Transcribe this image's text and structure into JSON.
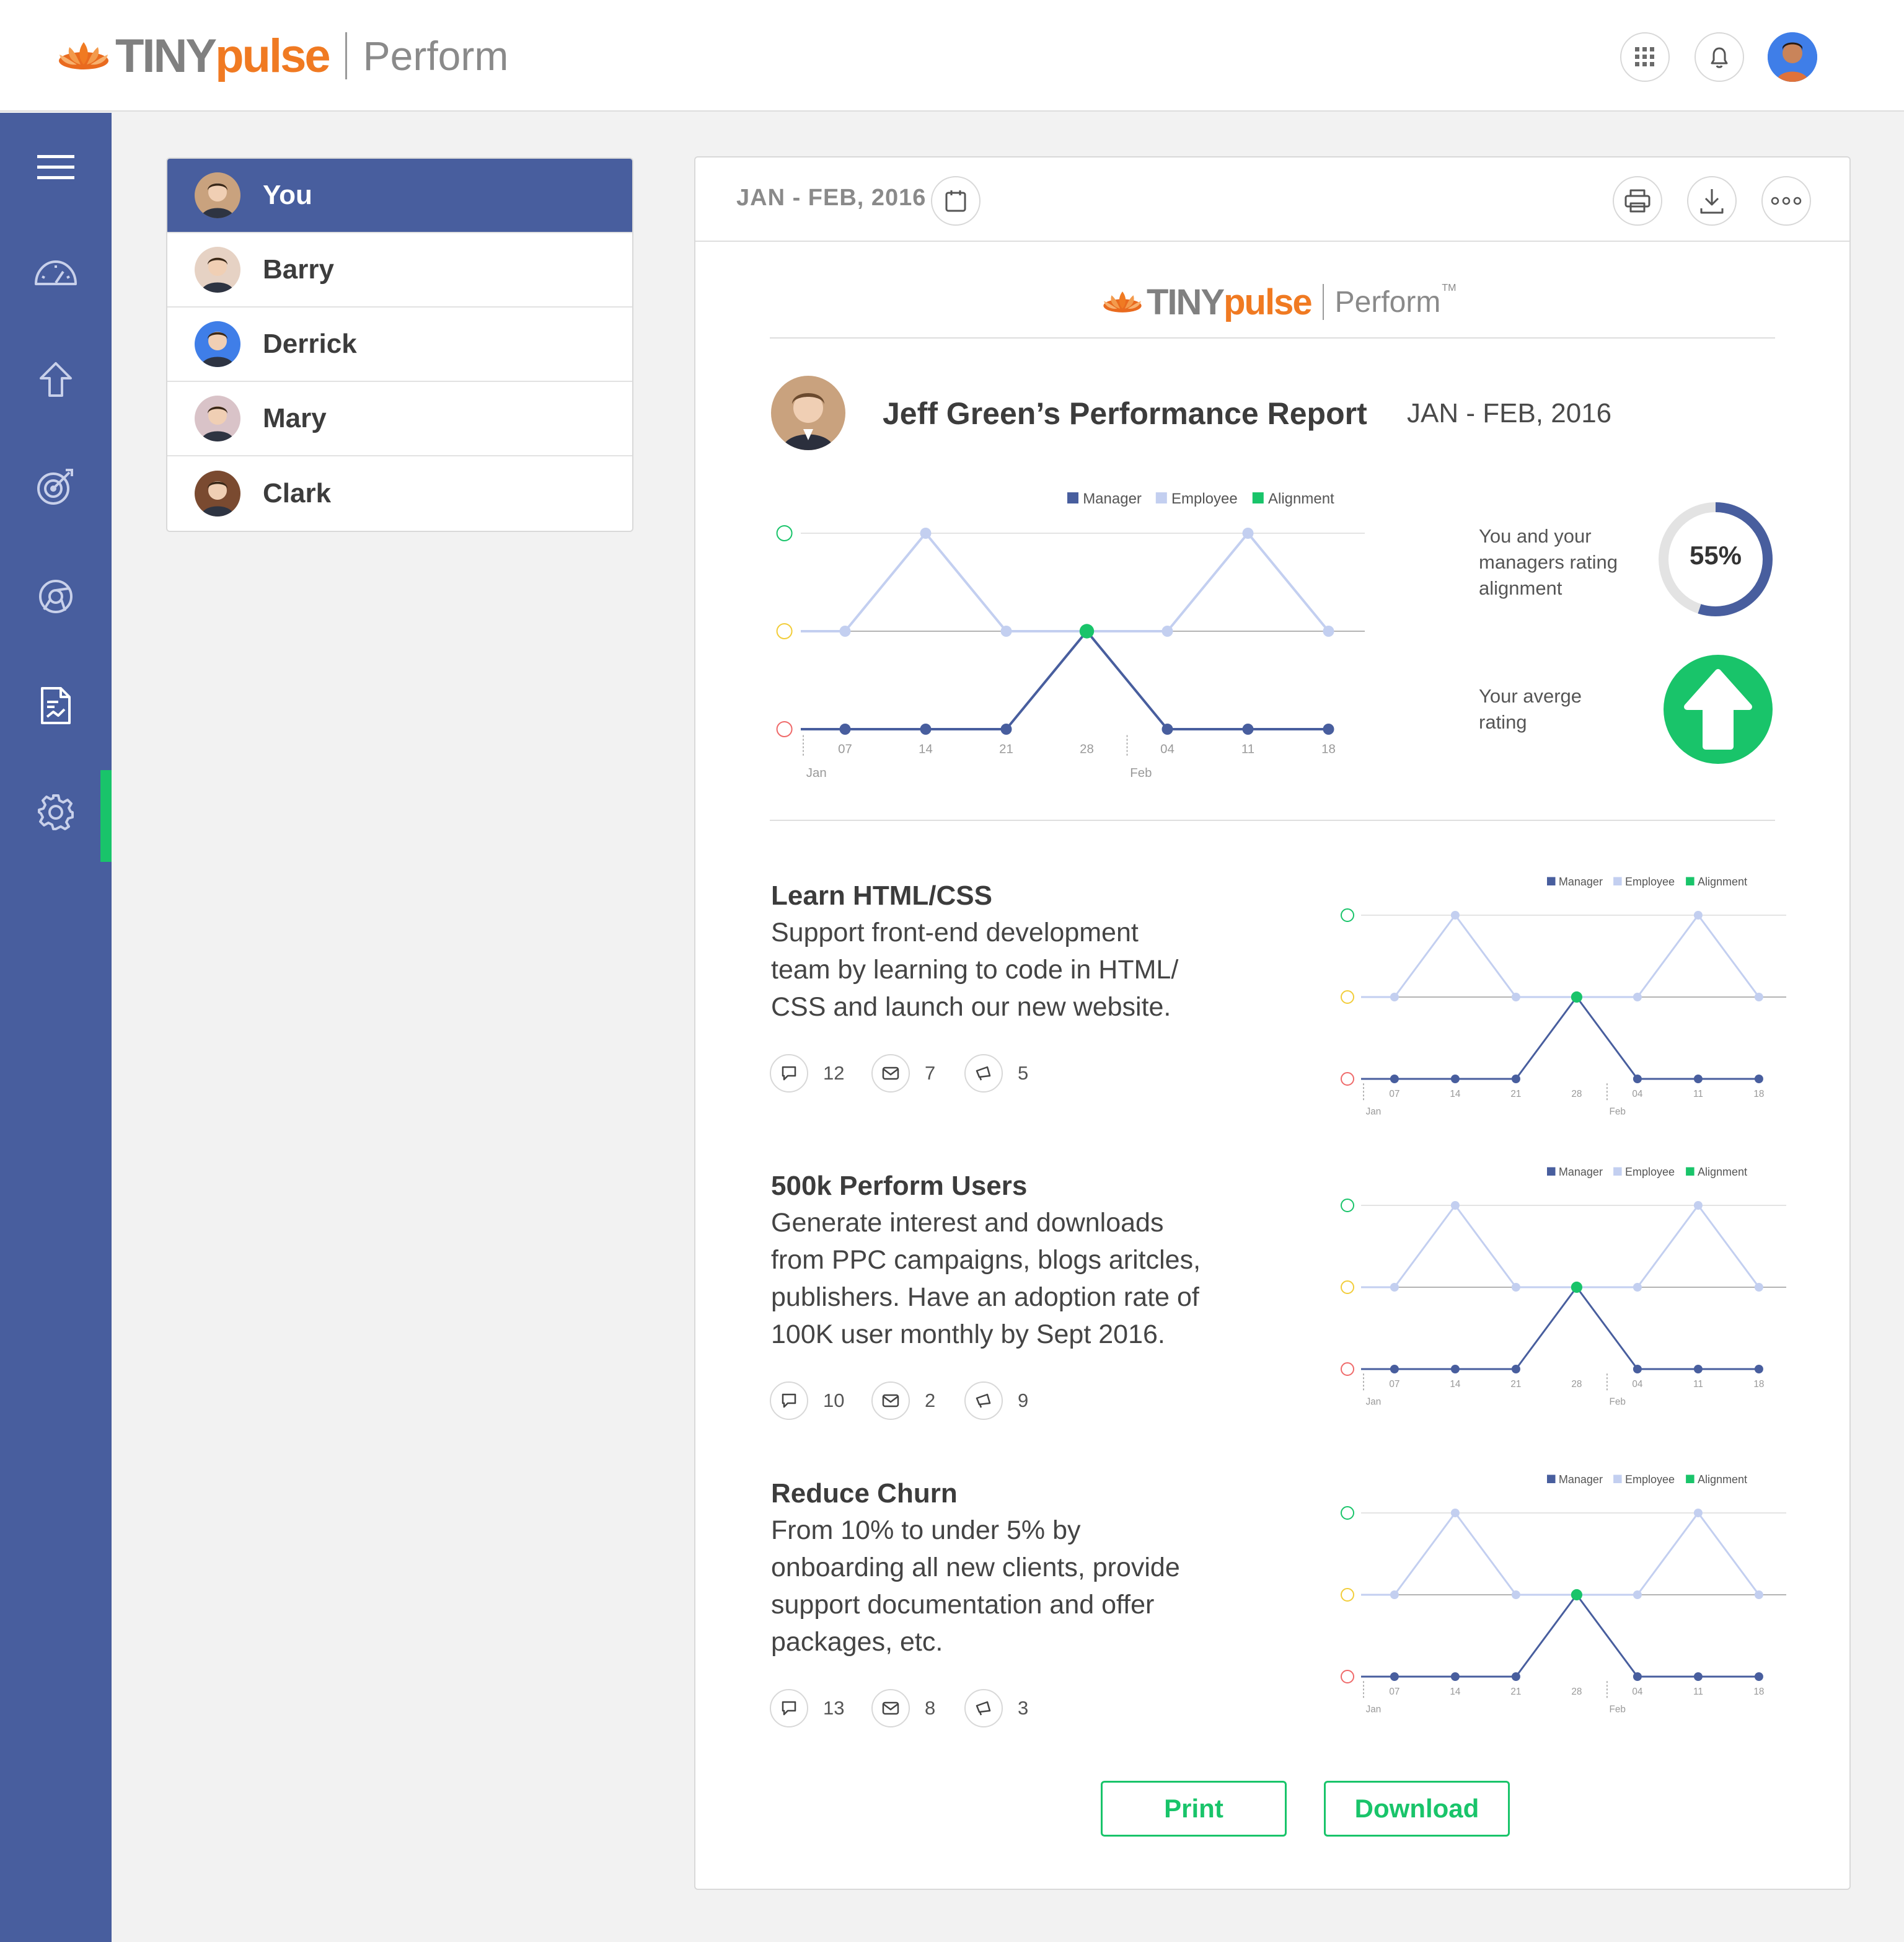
{
  "header": {
    "brand_tiny": "TINY",
    "brand_pulse": "pulse",
    "brand_perform": "Perform",
    "icons": [
      "apps-grid-icon",
      "bell-icon",
      "user-avatar"
    ]
  },
  "sidebar": {
    "items": [
      {
        "name": "menu",
        "icon": "hamburger-icon"
      },
      {
        "name": "dashboard",
        "icon": "speedometer-icon"
      },
      {
        "name": "updates",
        "icon": "arrow-up-icon"
      },
      {
        "name": "goals",
        "icon": "target-icon"
      },
      {
        "name": "reviews",
        "icon": "chrome-circle-icon"
      },
      {
        "name": "reports",
        "icon": "report-document-icon",
        "active": true
      },
      {
        "name": "settings",
        "icon": "gear-icon"
      }
    ]
  },
  "people": [
    {
      "name": "You",
      "active": true,
      "color": "#c9a27e"
    },
    {
      "name": "Barry",
      "active": false,
      "color": "#e6d2c4"
    },
    {
      "name": "Derrick",
      "active": false,
      "color": "#3f7ee8"
    },
    {
      "name": "Mary",
      "active": false,
      "color": "#d9c3c8"
    },
    {
      "name": "Clark",
      "active": false,
      "color": "#7a4a30"
    }
  ],
  "report": {
    "date_range": "JAN - FEB, 2016",
    "brand_tiny": "TINY",
    "brand_pulse": "pulse",
    "brand_perform": "Perform",
    "brand_tm": "TM",
    "title": "Jeff Green’s Performance Report",
    "subdate": "JAN - FEB, 2016",
    "alignment_text": [
      "You and your",
      "managers rating",
      "alignment"
    ],
    "alignment_value": "55%",
    "alignment_fraction": 0.55,
    "average_text": [
      "Your averge",
      "rating"
    ],
    "average_direction": "up"
  },
  "chart_data": [
    {
      "type": "line",
      "legend": [
        "Manager",
        "Employee",
        "Alignment"
      ],
      "x": [
        "07",
        "14",
        "21",
        "28",
        "04",
        "11",
        "18"
      ],
      "month_labels": [
        "Jan",
        "Feb"
      ],
      "series": [
        {
          "name": "Manager",
          "color": "#485e9e",
          "values": [
            0,
            0,
            0,
            1,
            0,
            0,
            0
          ]
        },
        {
          "name": "Employee",
          "color": "#c3cff0",
          "values": [
            1,
            2,
            1,
            1,
            1,
            2,
            1
          ]
        },
        {
          "name": "Alignment",
          "color": "#19c46a",
          "values": [
            null,
            null,
            null,
            1,
            null,
            null,
            null
          ]
        }
      ],
      "y_levels": [
        "down",
        "neutral",
        "up"
      ]
    }
  ],
  "goals": [
    {
      "title": "Learn HTML/CSS",
      "desc": [
        "Support front-end development",
        "team by learning to code in HTML/",
        "CSS and launch our new website."
      ],
      "comments": "12",
      "messages": "7",
      "shoutouts": "5"
    },
    {
      "title": "500k Perform Users",
      "desc": [
        "Generate interest and downloads",
        "from PPC campaigns, blogs aritcles,",
        "publishers. Have an adoption rate of",
        "100K user monthly by Sept 2016."
      ],
      "comments": "10",
      "messages": "2",
      "shoutouts": "9"
    },
    {
      "title": "Reduce Churn",
      "desc": [
        "From 10% to under 5% by",
        "onboarding all new clients, provide",
        "support documentation and offer",
        "packages, etc."
      ],
      "comments": "13",
      "messages": "8",
      "shoutouts": "3"
    }
  ],
  "actions": {
    "print": "Print",
    "download": "Download"
  },
  "colors": {
    "sidebar": "#485e9e",
    "accent": "#19c46a",
    "brand_orange": "#f07a22"
  }
}
